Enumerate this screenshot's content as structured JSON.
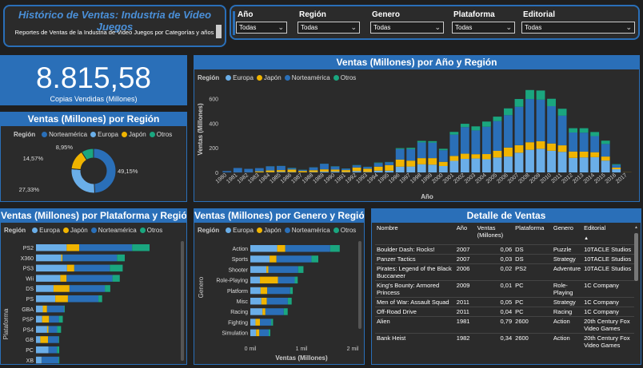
{
  "header": {
    "title": "Histórico de Ventas: Industria de Video Juegos",
    "subtitle": "Reportes de Ventas de la Industria de Video Juegos por Categorías y años"
  },
  "filters": [
    {
      "label": "Año",
      "value": "Todas"
    },
    {
      "label": "Región",
      "value": "Todas"
    },
    {
      "label": "Genero",
      "value": "Todas"
    },
    {
      "label": "Plataforma",
      "value": "Todas"
    },
    {
      "label": "Editorial",
      "value": "Todas"
    }
  ],
  "kpi": {
    "value": "8.815,58",
    "label": "Copias Vendidas (Millones)"
  },
  "colors": {
    "europa": "#6aaee8",
    "japon": "#f0b400",
    "norteamerica": "#2a6fb8",
    "otros": "#1aa67f",
    "accent": "#2a6fb8"
  },
  "legend_label": "Región",
  "legend_names": {
    "europa": "Europa",
    "japon": "Japón",
    "norteamerica": "Norteamérica",
    "otros": "Otros"
  },
  "donut": {
    "title": "Ventas (Millones) por Región",
    "chart_data": {
      "type": "pie",
      "labels": [
        "Norteamérica",
        "Europa",
        "Japón",
        "Otros"
      ],
      "values": [
        49.15,
        27.33,
        14.57,
        8.95
      ],
      "value_labels": [
        "49,15%",
        "27,33%",
        "14,57%",
        "8,95%"
      ]
    }
  },
  "year_chart": {
    "title": "Ventas (Millones) por Año y Región",
    "xlabel": "Año",
    "ylabel": "Ventas (Millones)",
    "chart_data": {
      "type": "bar",
      "stacked": true,
      "ylim": [
        0,
        700
      ],
      "yticks": [
        0,
        200,
        400,
        600
      ],
      "categories": [
        "1980",
        "1981",
        "1982",
        "1983",
        "1984",
        "1985",
        "1986",
        "1987",
        "1988",
        "1989",
        "1990",
        "1991",
        "1992",
        "1993",
        "1994",
        "1995",
        "1996",
        "1997",
        "1998",
        "1999",
        "2000",
        "2001",
        "2002",
        "2003",
        "2004",
        "2005",
        "2006",
        "2007",
        "2008",
        "2009",
        "2010",
        "2011",
        "2012",
        "2013",
        "2014",
        "2015",
        "2016",
        "2017"
      ],
      "series": [
        {
          "name": "Norteamérica",
          "values": [
            10,
            34,
            27,
            26,
            33,
            33,
            12,
            9,
            23,
            45,
            25,
            12,
            18,
            15,
            29,
            24,
            86,
            94,
            128,
            126,
            94,
            173,
            216,
            193,
            222,
            242,
            263,
            312,
            351,
            338,
            303,
            241,
            154,
            154,
            131,
            102,
            22,
            0
          ]
        },
        {
          "name": "Europa",
          "values": [
            1,
            2,
            2,
            1,
            2,
            5,
            3,
            1,
            3,
            7,
            8,
            3,
            11,
            4,
            14,
            14,
            47,
            48,
            66,
            63,
            52,
            94,
            110,
            113,
            107,
            121,
            129,
            160,
            184,
            192,
            176,
            167,
            118,
            122,
            124,
            96,
            26,
            0
          ]
        },
        {
          "name": "Japón",
          "values": [
            0,
            0,
            0,
            8,
            14,
            14,
            20,
            11,
            15,
            18,
            15,
            16,
            29,
            26,
            33,
            45,
            57,
            48,
            50,
            53,
            34,
            40,
            42,
            35,
            42,
            54,
            73,
            61,
            61,
            61,
            59,
            53,
            52,
            47,
            40,
            33,
            13,
            1
          ]
        },
        {
          "name": "Otros",
          "values": [
            0,
            0,
            0,
            0,
            1,
            1,
            2,
            1,
            1,
            1,
            2,
            1,
            2,
            1,
            4,
            2,
            7,
            10,
            12,
            12,
            12,
            22,
            27,
            33,
            42,
            36,
            55,
            63,
            73,
            74,
            60,
            56,
            35,
            36,
            33,
            27,
            6,
            0
          ]
        }
      ]
    }
  },
  "platform_chart": {
    "title": "Ventas (Millones) por Plataforma y Región",
    "ylabel": "Plataforma",
    "chart_data": {
      "type": "bar",
      "orientation": "horizontal",
      "stacked": true,
      "categories": [
        "PS2",
        "X360",
        "PS3",
        "Wii",
        "DS",
        "PS",
        "GBA",
        "PSP",
        "PS4",
        "GB",
        "PC",
        "XB"
      ],
      "series": [
        {
          "name": "Europa",
          "values": [
            339,
            280,
            343,
            269,
            194,
            213,
            75,
            68,
            123,
            48,
            139,
            61
          ]
        },
        {
          "name": "Japón",
          "values": [
            139,
            13,
            80,
            69,
            176,
            140,
            47,
            76,
            14,
            85,
            0,
            1
          ]
        },
        {
          "name": "Norteamérica",
          "values": [
            584,
            602,
            393,
            507,
            391,
            337,
            188,
            109,
            97,
            114,
            93,
            187
          ]
        },
        {
          "name": "Otros",
          "values": [
            193,
            86,
            142,
            81,
            60,
            41,
            8,
            43,
            43,
            8,
            25,
            9
          ]
        }
      ]
    }
  },
  "genre_chart": {
    "title": "Ventas (Millones) por Genero y Región",
    "ylabel": "Genero",
    "xlabel": "Ventas (Millones)",
    "chart_data": {
      "type": "bar",
      "orientation": "horizontal",
      "stacked": true,
      "xlim": [
        0,
        2000
      ],
      "xticks": [
        0,
        1000,
        2000
      ],
      "xtick_labels": [
        "0 mil",
        "1 mil",
        "2 mil"
      ],
      "categories": [
        "Action",
        "Sports",
        "Shooter",
        "Role-Playing",
        "Platform",
        "Misc",
        "Racing",
        "Fighting",
        "Simulation"
      ],
      "series": [
        {
          "name": "Europa",
          "values": [
            525,
            376,
            314,
            188,
            201,
            216,
            238,
            101,
            113
          ]
        },
        {
          "name": "Japón",
          "values": [
            158,
            135,
            38,
            352,
            130,
            107,
            56,
            87,
            63
          ]
        },
        {
          "name": "Norteamérica",
          "values": [
            877,
            683,
            582,
            327,
            447,
            410,
            359,
            220,
            183
          ]
        },
        {
          "name": "Otros",
          "values": [
            187,
            134,
            104,
            59,
            51,
            75,
            77,
            36,
            31
          ]
        }
      ]
    }
  },
  "sales_table": {
    "title": "Detalle de Ventas",
    "columns": [
      "Nombre",
      "Año",
      "Ventas (Millones)",
      "Plataforma",
      "Genero",
      "Editorial"
    ],
    "rows": [
      [
        "Boulder Dash: Rocks!",
        "2007",
        "0,06",
        "DS",
        "Puzzle",
        "10TACLE Studios"
      ],
      [
        "Panzer Tactics",
        "2007",
        "0,03",
        "DS",
        "Strategy",
        "10TACLE Studios"
      ],
      [
        "Pirates: Legend of the Black Buccaneer",
        "2006",
        "0,02",
        "PS2",
        "Adventure",
        "10TACLE Studios"
      ],
      [
        "King's Bounty: Armored Princess",
        "2009",
        "0,01",
        "PC",
        "Role-Playing",
        "1C Company"
      ],
      [
        "Men of War: Assault Squad",
        "2011",
        "0,05",
        "PC",
        "Strategy",
        "1C Company"
      ],
      [
        "Off-Road Drive",
        "2011",
        "0,04",
        "PC",
        "Racing",
        "1C Company"
      ],
      [
        "Alien",
        "1981",
        "0,79",
        "2600",
        "Action",
        "20th Century Fox Video Games"
      ],
      [
        "Bank Heist",
        "1982",
        "0,34",
        "2600",
        "Action",
        "20th Century Fox Video Games"
      ]
    ]
  }
}
